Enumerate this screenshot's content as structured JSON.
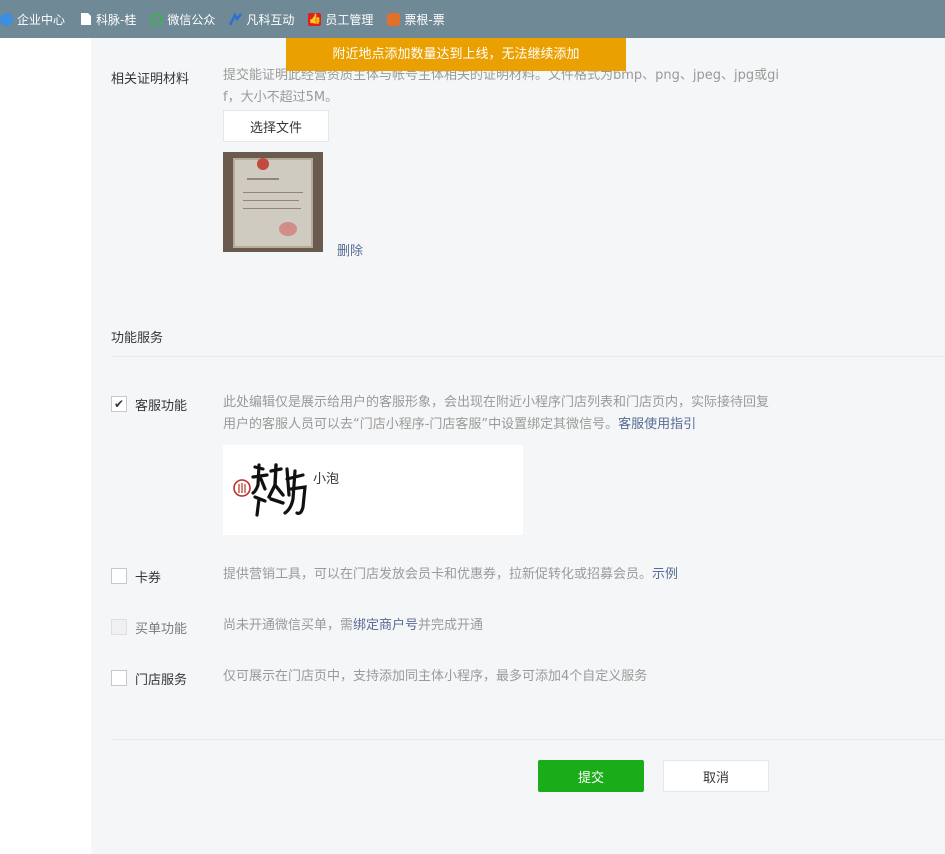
{
  "bookmarks": [
    {
      "label": "企业中心",
      "icon": "bookmark-globe-icon",
      "color": "#3b8ee0"
    },
    {
      "label": "科脉-桂",
      "icon": "page-icon",
      "color": "#ffffff"
    },
    {
      "label": "微信公众",
      "icon": "wechat-icon",
      "color": "#3ab54a"
    },
    {
      "label": "凡科互动",
      "icon": "fanke-icon",
      "color": "#2e6fd6"
    },
    {
      "label": "员工管理",
      "icon": "thumb-up-icon",
      "color": "#e02020"
    },
    {
      "label": "票根-票",
      "icon": "ticket-icon",
      "color": "#e0702a"
    }
  ],
  "toast": {
    "text": "附近地点添加数量达到上线，无法继续添加",
    "color": "#e9a000"
  },
  "proof": {
    "label": "相关证明材料",
    "desc_line1": "提交能证明此经营资质主体与帐号主体相关的证明材料。文件格式为bmp、png、jpeg、jpg或gi",
    "desc_line2": "f，大小不超过5M。",
    "choose_file": "选择文件",
    "delete": "删除"
  },
  "section_title": "功能服务",
  "services": {
    "customer_service": {
      "label": "客服功能",
      "checked": true,
      "desc_line1": "此处编辑仅是展示给用户的客服形象，会出现在附近小程序门店列表和门店页内，实际接待回复",
      "desc_line2": "用户的客服人员可以去“门店小程序-门店客服”中设置绑定其微信号。",
      "link": "客服使用指引",
      "agent_name": "小泡"
    },
    "coupon": {
      "label": "卡券",
      "checked": false,
      "desc": "提供营销工具，可以在门店发放会员卡和优惠券，拉新促转化或招募会员。",
      "link": "示例"
    },
    "pay": {
      "label": "买单功能",
      "disabled": true,
      "desc_before": "尚未开通微信买单，需",
      "link": "绑定商户号",
      "desc_after": "并完成开通"
    },
    "store": {
      "label": "门店服务",
      "checked": false,
      "desc": "仅可展示在门店页中，支持添加同主体小程序，最多可添加4个自定义服务"
    }
  },
  "actions": {
    "submit": "提交",
    "cancel": "取消"
  },
  "colors": {
    "primary": "#1aad19",
    "link": "#576b95",
    "muted": "#9a9a9a"
  }
}
